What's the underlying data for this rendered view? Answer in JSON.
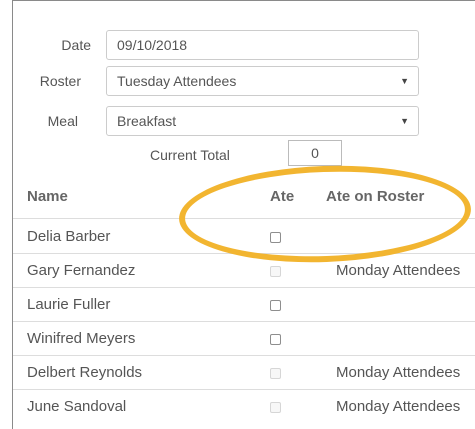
{
  "form": {
    "date_label": "Date",
    "date_value": "09/10/2018",
    "roster_label": "Roster",
    "roster_value": "Tuesday Attendees",
    "meal_label": "Meal",
    "meal_value": "Breakfast",
    "current_total_label": "Current Total",
    "current_total_value": "0",
    "dropdown_caret": "▼"
  },
  "table": {
    "headers": {
      "name": "Name",
      "ate": "Ate",
      "ate_on_roster": "Ate on Roster"
    },
    "rows": [
      {
        "name": "Delia Barber",
        "checkbox_enabled": true,
        "checked": false,
        "roster": ""
      },
      {
        "name": "Gary Fernandez",
        "checkbox_enabled": false,
        "checked": false,
        "roster": "Monday Attendees"
      },
      {
        "name": "Laurie Fuller",
        "checkbox_enabled": true,
        "checked": false,
        "roster": ""
      },
      {
        "name": "Winifred Meyers",
        "checkbox_enabled": true,
        "checked": false,
        "roster": ""
      },
      {
        "name": "Delbert Reynolds",
        "checkbox_enabled": false,
        "checked": false,
        "roster": "Monday Attendees"
      },
      {
        "name": "June Sandoval",
        "checkbox_enabled": false,
        "checked": false,
        "roster": "Monday Attendees"
      }
    ]
  },
  "colors": {
    "highlight_ellipse": "#f2b530"
  }
}
